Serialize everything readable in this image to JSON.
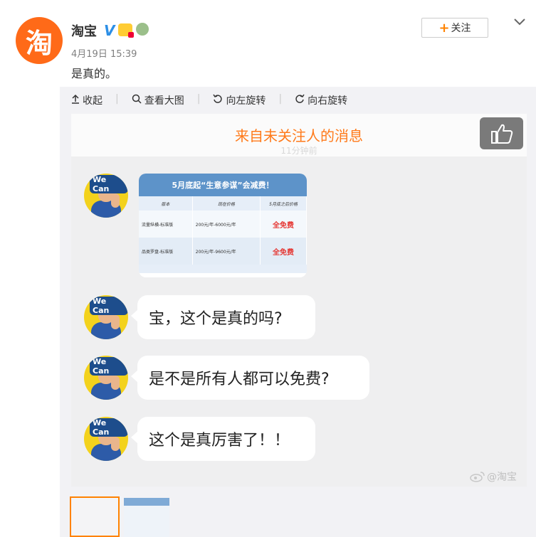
{
  "post": {
    "author": "淘宝",
    "avatar_text": "淘",
    "verified_mark": "V",
    "timestamp": "4月19日 15:39",
    "text": "是真的。",
    "follow_label": "关注"
  },
  "toolbar": {
    "items": [
      {
        "icon": "collapse-icon",
        "label": "收起"
      },
      {
        "icon": "zoom-icon",
        "label": "查看大图"
      },
      {
        "icon": "rotate-left-icon",
        "label": "向左旋转"
      },
      {
        "icon": "rotate-right-icon",
        "label": "向右旋转"
      }
    ]
  },
  "screenshot": {
    "title": "来自未关注人的消息",
    "subtitle": "11分钟前",
    "avatar_text": "We Can",
    "card": {
      "title": "5月底起“生意参谋”会减费！",
      "headers": [
        "版本",
        "现在价格",
        "5月底之后价格"
      ],
      "rows": [
        [
          "流量纵横-标准版",
          "200元/年-6000元/年",
          "全免费"
        ],
        [
          "品类罗盘-标准版",
          "200元/年-9600元/年",
          "全免费"
        ]
      ]
    },
    "messages": [
      "宝，这个是真的吗?",
      "是不是所有人都可以免费?",
      "这个是真厉害了！！"
    ],
    "watermark": "@淘宝"
  },
  "colors": {
    "accent_orange": "#ff7a1a",
    "verified_blue": "#2d8fe6",
    "free_red": "#e53935"
  }
}
